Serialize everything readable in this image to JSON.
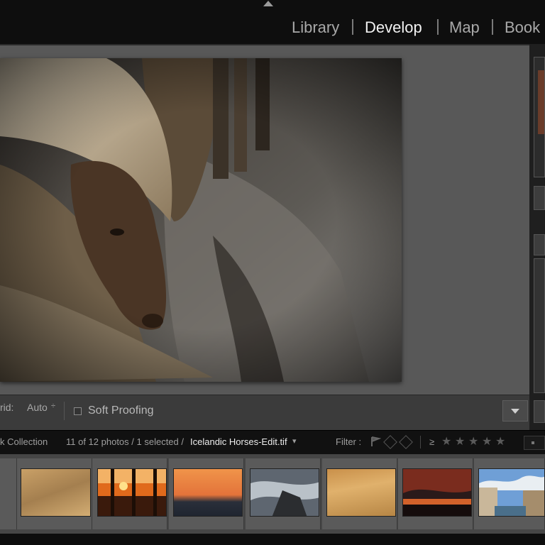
{
  "modules": {
    "library": "Library",
    "develop": "Develop",
    "map": "Map",
    "book": "Book"
  },
  "toolbar": {
    "grid_label": "rid:",
    "grid_value": "Auto",
    "grid_stepper": "÷",
    "soft_proofing": "Soft Proofing"
  },
  "filmstrip_header": {
    "source": "k Collection",
    "count": "11 of 12 photos / 1 selected /",
    "filename": "Icelandic Horses-Edit.tif",
    "filename_arrow": "▾",
    "filter_label": "Filter :",
    "rating_operator": "≥",
    "stars": [
      "★",
      "★",
      "★",
      "★",
      "★"
    ]
  },
  "filmstrip": {
    "thumbnails": [
      {
        "subject": "sand ripples"
      },
      {
        "subject": "sunset between pier posts"
      },
      {
        "subject": "orange sunset over water"
      },
      {
        "subject": "surf over rocks"
      },
      {
        "subject": "golden sand"
      },
      {
        "subject": "dramatic red sky"
      },
      {
        "subject": "canal with buildings"
      }
    ]
  },
  "colors": {
    "active_module": "#f2f2f2",
    "inactive_module": "#a9a9a9",
    "workspace": "#585858"
  }
}
